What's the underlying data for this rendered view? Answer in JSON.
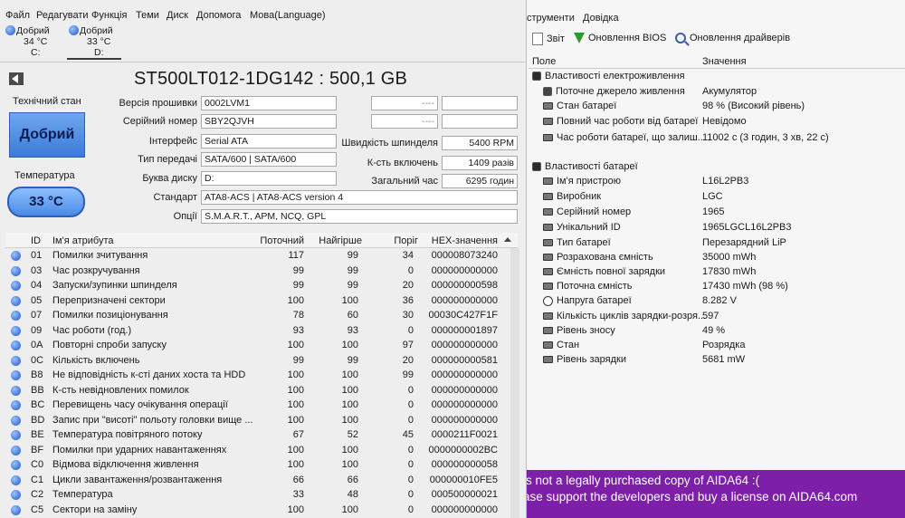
{
  "aida": {
    "menu": [
      "струменти",
      "Довідка"
    ],
    "toolbar": {
      "report": "Звіт",
      "bios": "Оновлення BIOS",
      "drivers": "Оновлення драйверів"
    },
    "columns": {
      "field": "Поле",
      "value": "Значення"
    },
    "groups": [
      {
        "title": "Властивості електроживлення",
        "rows": [
          {
            "name": "Поточне джерело живлення",
            "value": "Акумулятор",
            "icon": "power-icon"
          },
          {
            "name": "Стан батареї",
            "value": "98 % (Високий рівень)",
            "icon": "battery-icon"
          },
          {
            "name": "Повний час роботи від батареї",
            "value": "Невідомо",
            "icon": "battery-icon"
          },
          {
            "name": "Час роботи батареї, що залиш...",
            "value": "11002 с (3 годин, 3 хв, 22 с)",
            "icon": "battery-icon"
          }
        ]
      },
      {
        "title": "Властивості батареї",
        "rows": [
          {
            "name": "Ім'я пристрою",
            "value": "L16L2PB3",
            "icon": "battery-icon"
          },
          {
            "name": "Виробник",
            "value": "LGC",
            "icon": "battery-icon"
          },
          {
            "name": "Серійний номер",
            "value": "1965",
            "icon": "battery-icon"
          },
          {
            "name": "Унікальний ID",
            "value": "1965LGCL16L2PB3",
            "icon": "battery-icon"
          },
          {
            "name": "Тип батареї",
            "value": "Перезарядний LiP",
            "icon": "battery-icon"
          },
          {
            "name": "Розрахована ємність",
            "value": "35000 mWh",
            "icon": "battery-icon"
          },
          {
            "name": "Ємність повної зарядки",
            "value": "17830 mWh",
            "icon": "battery-icon"
          },
          {
            "name": "Поточна ємність",
            "value": "17430 mWh  (98 %)",
            "icon": "battery-icon"
          },
          {
            "name": "Напруга батареї",
            "value": "8.282 V",
            "icon": "voltage-icon"
          },
          {
            "name": "Кількість циклів зарядки-розря...",
            "value": "597",
            "icon": "battery-icon"
          },
          {
            "name": "Рівень зносу",
            "value": "49 %",
            "icon": "battery-icon"
          },
          {
            "name": "Стан",
            "value": "Розрядка",
            "icon": "battery-icon"
          },
          {
            "name": "Рівень зарядки",
            "value": "5681 mW",
            "icon": "battery-icon"
          }
        ]
      }
    ],
    "banner": {
      "line1": "is not a legally purchased copy of AIDA64 :(",
      "line2": "ase support the developers and buy a license on AIDA64.com"
    }
  },
  "cdi": {
    "menu": [
      "Файл",
      "Редагувати",
      "Функція",
      "Теми",
      "Диск",
      "Допомога",
      "Мова(Language)"
    ],
    "disks": [
      {
        "status": "Добрий",
        "temp": "34 °C",
        "drive": "C:"
      },
      {
        "status": "Добрий",
        "temp": "33 °C",
        "drive": "D:"
      }
    ],
    "title": "ST500LT012-1DG142 : 500,1 GB",
    "health_label": "Технічний стан",
    "health_value": "Добрий",
    "temp_label": "Температура",
    "temp_value": "33 °C",
    "fields": {
      "firmware_label": "Версія прошивки",
      "firmware": "0002LVM1",
      "serial_label": "Серійний номер",
      "serial": "SBY2QJVH",
      "interface_label": "Інтерфейс",
      "interface": "Serial ATA",
      "transfer_label": "Тип передачі",
      "transfer": "SATA/600 | SATA/600",
      "letter_label": "Буква диску",
      "letter": "D:",
      "standard_label": "Стандарт",
      "standard": "ATA8-ACS | ATA8-ACS version 4",
      "features_label": "Опції",
      "features": "S.M.A.R.T., APM, NCQ, GPL",
      "rpm_label": "Швидкість шпинделя",
      "rpm": "5400 RPM",
      "poweron_count_label": "К-сть включень",
      "poweron_count": "1409 разів",
      "hours_label": "Загальний час",
      "hours": "6295 годин",
      "dash1": "----",
      "dash2": "----"
    },
    "attr_headers": {
      "id": "ID",
      "name": "Ім'я атрибута",
      "current": "Поточний",
      "worst": "Найгірше",
      "threshold": "Поріг",
      "raw": "HEX-значення"
    },
    "attributes": [
      {
        "id": "01",
        "name": "Помилки зчитування",
        "current": "117",
        "worst": "99",
        "threshold": "34",
        "raw": "000008073240"
      },
      {
        "id": "03",
        "name": "Час розкручування",
        "current": "99",
        "worst": "99",
        "threshold": "0",
        "raw": "000000000000"
      },
      {
        "id": "04",
        "name": "Запуски/зупинки шпинделя",
        "current": "99",
        "worst": "99",
        "threshold": "20",
        "raw": "000000000598"
      },
      {
        "id": "05",
        "name": "Перепризначені сектори",
        "current": "100",
        "worst": "100",
        "threshold": "36",
        "raw": "000000000000"
      },
      {
        "id": "07",
        "name": "Помилки позиціонування",
        "current": "78",
        "worst": "60",
        "threshold": "30",
        "raw": "00030C427F1F"
      },
      {
        "id": "09",
        "name": "Час роботи (год.)",
        "current": "93",
        "worst": "93",
        "threshold": "0",
        "raw": "000000001897"
      },
      {
        "id": "0A",
        "name": "Повторні спроби запуску",
        "current": "100",
        "worst": "100",
        "threshold": "97",
        "raw": "000000000000"
      },
      {
        "id": "0C",
        "name": "Кількість включень",
        "current": "99",
        "worst": "99",
        "threshold": "20",
        "raw": "000000000581"
      },
      {
        "id": "B8",
        "name": "Не відповідність к-сті даних хоста та HDD",
        "current": "100",
        "worst": "100",
        "threshold": "99",
        "raw": "000000000000"
      },
      {
        "id": "BB",
        "name": "К-сть невідновлених помилок",
        "current": "100",
        "worst": "100",
        "threshold": "0",
        "raw": "000000000000"
      },
      {
        "id": "BC",
        "name": "Перевищень часу очікування операції",
        "current": "100",
        "worst": "100",
        "threshold": "0",
        "raw": "000000000000"
      },
      {
        "id": "BD",
        "name": "Запис при \"висоті\" польоту головки вище ...",
        "current": "100",
        "worst": "100",
        "threshold": "0",
        "raw": "000000000000"
      },
      {
        "id": "BE",
        "name": "Температура повітряного потоку",
        "current": "67",
        "worst": "52",
        "threshold": "45",
        "raw": "0000211F0021"
      },
      {
        "id": "BF",
        "name": "Помилки при ударних навантаженнях",
        "current": "100",
        "worst": "100",
        "threshold": "0",
        "raw": "0000000002BC"
      },
      {
        "id": "C0",
        "name": "Відмова відключення живлення",
        "current": "100",
        "worst": "100",
        "threshold": "0",
        "raw": "000000000058"
      },
      {
        "id": "C1",
        "name": "Цикли завантаження/розвантаження",
        "current": "66",
        "worst": "66",
        "threshold": "0",
        "raw": "000000010FE5"
      },
      {
        "id": "C2",
        "name": "Температура",
        "current": "33",
        "worst": "48",
        "threshold": "0",
        "raw": "000500000021"
      },
      {
        "id": "C5",
        "name": "Сектори на заміну",
        "current": "100",
        "worst": "100",
        "threshold": "0",
        "raw": "000000000000"
      }
    ]
  },
  "colors": {
    "banner": "#7e1faa",
    "health": "#3b7bd8",
    "status_dot": "#1f55c8"
  }
}
